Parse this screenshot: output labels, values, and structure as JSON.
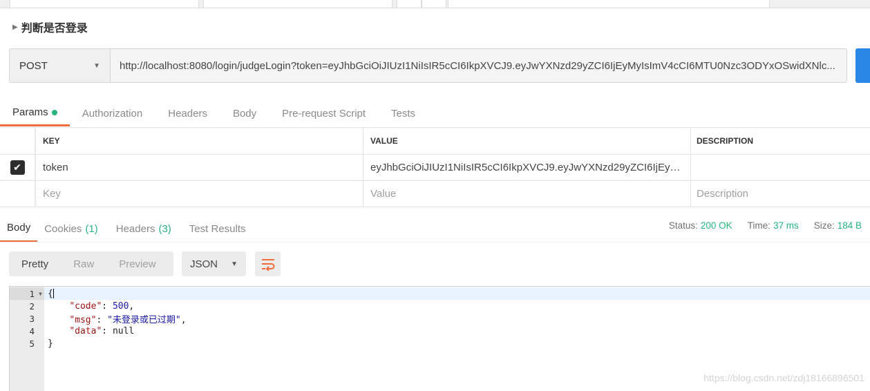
{
  "request": {
    "name": "判断是否登录",
    "method": "POST",
    "url": "http://localhost:8080/login/judgeLogin?token=eyJhbGciOiJIUzI1NiIsIR5cCI6IkpXVCJ9.eyJwYXNzd29yZCI6IjEyMyIsImV4cCI6MTU0Nzc3ODYxOSwidXNlc..."
  },
  "request_tabs": [
    {
      "label": "Params"
    },
    {
      "label": "Authorization"
    },
    {
      "label": "Headers"
    },
    {
      "label": "Body"
    },
    {
      "label": "Pre-request Script"
    },
    {
      "label": "Tests"
    }
  ],
  "params_table": {
    "headers": {
      "key": "KEY",
      "value": "VALUE",
      "description": "DESCRIPTION"
    },
    "rows": [
      {
        "key": "token",
        "value": "eyJhbGciOiJIUzI1NiIsIR5cCI6IkpXVCJ9.eyJwYXNzd29yZCI6IjEyMyI...",
        "description": "",
        "checked": true
      }
    ],
    "placeholders": {
      "key": "Key",
      "value": "Value",
      "description": "Description"
    }
  },
  "response_tabs": [
    {
      "label": "Body",
      "count": ""
    },
    {
      "label": "Cookies",
      "count": "(1)"
    },
    {
      "label": "Headers",
      "count": "(3)"
    },
    {
      "label": "Test Results",
      "count": ""
    }
  ],
  "status": {
    "status_label": "Status:",
    "status_value": "200 OK",
    "time_label": "Time:",
    "time_value": "37 ms",
    "size_label": "Size:",
    "size_value": "184 B"
  },
  "view_modes": [
    "Pretty",
    "Raw",
    "Preview"
  ],
  "format": "JSON",
  "response_body": {
    "line_numbers": [
      "1",
      "2",
      "3",
      "4",
      "5"
    ],
    "open_brace": "{",
    "close_brace": "}",
    "code_key": "\"code\"",
    "code_value": "500",
    "msg_key": "\"msg\"",
    "msg_value": "\"未登录或已过期\"",
    "data_key": "\"data\"",
    "data_value": "null"
  },
  "watermark": "https://blog.csdn.net/zdj18166896501",
  "colors": {
    "accent": "#f06c3b",
    "success": "#26b47f",
    "send": "#2a86e5"
  }
}
